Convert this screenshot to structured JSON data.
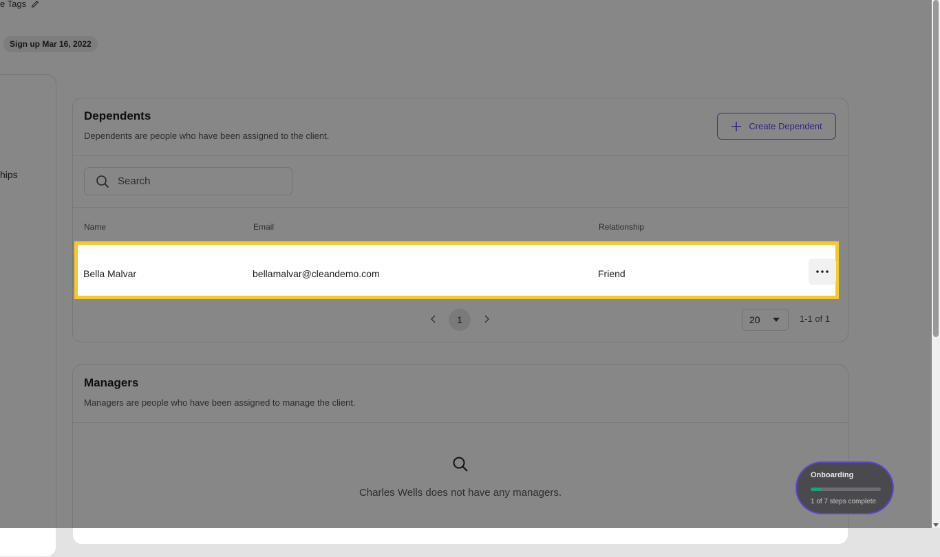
{
  "header": {
    "tags_label": "e Tags",
    "signup_badge": "Sign up Mar 16, 2022"
  },
  "sidebar": {
    "partial_label": "hips"
  },
  "dependents": {
    "title": "Dependents",
    "subtitle": "Dependents are people who have been assigned to the client.",
    "create_button": "Create Dependent",
    "search_placeholder": "Search",
    "columns": {
      "name": "Name",
      "email": "Email",
      "relationship": "Relationship"
    },
    "rows": [
      {
        "name": "Bella Malvar",
        "email": "bellamalvar@cleandemo.com",
        "relationship": "Friend"
      }
    ],
    "pagination": {
      "current_page": "1",
      "page_size": "20",
      "range": "1-1 of 1"
    }
  },
  "managers": {
    "title": "Managers",
    "subtitle": "Managers are people who have been assigned to manage the client.",
    "empty_text": "Charles Wells does not have any managers."
  },
  "onboarding": {
    "title": "Onboarding",
    "steps_text": "1 of 7 steps complete",
    "progress": 0.143
  },
  "colors": {
    "accent": "#5a49e8",
    "highlight": "#f3c930",
    "progress": "#1fa07a"
  }
}
